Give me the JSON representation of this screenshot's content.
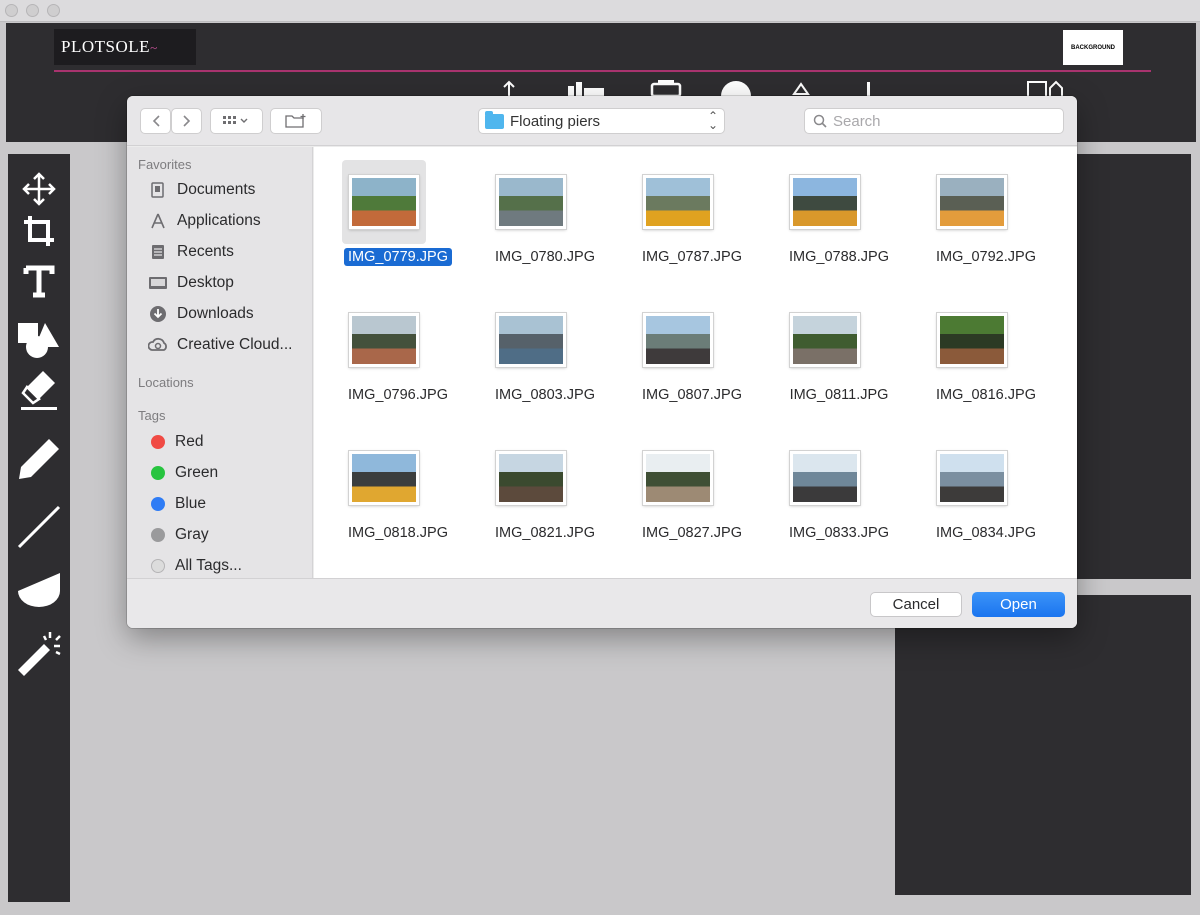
{
  "app": {
    "logo_text": "PLOTSOLE",
    "logo_swash": "~",
    "background_button": "BACKGROUND"
  },
  "dialog": {
    "path": "Floating piers",
    "search_placeholder": "Search",
    "sidebar": {
      "favorites_header": "Favorites",
      "favorites": [
        {
          "label": "Documents",
          "icon": "documents-icon"
        },
        {
          "label": "Applications",
          "icon": "applications-icon"
        },
        {
          "label": "Recents",
          "icon": "recents-icon"
        },
        {
          "label": "Desktop",
          "icon": "desktop-icon"
        },
        {
          "label": "Downloads",
          "icon": "downloads-icon"
        },
        {
          "label": "Creative Cloud...",
          "icon": "creative-cloud-icon"
        }
      ],
      "locations_header": "Locations",
      "tags_header": "Tags",
      "tags": [
        {
          "label": "Red",
          "color": "#f04a44"
        },
        {
          "label": "Green",
          "color": "#27c43f"
        },
        {
          "label": "Blue",
          "color": "#2f7cf5"
        },
        {
          "label": "Gray",
          "color": "#9a9a9c"
        },
        {
          "label": "All Tags...",
          "color": "#dcdcdc"
        }
      ]
    },
    "files": [
      {
        "name": "IMG_0779.JPG",
        "selected": true,
        "colors": [
          "#8db3c9",
          "#4f7a3a",
          "#c26a3a"
        ]
      },
      {
        "name": "IMG_0780.JPG",
        "selected": false,
        "colors": [
          "#9ab8cc",
          "#55704a",
          "#6f7a7f"
        ]
      },
      {
        "name": "IMG_0787.JPG",
        "selected": false,
        "colors": [
          "#9fc0d8",
          "#6b7a5f",
          "#e0a220"
        ]
      },
      {
        "name": "IMG_0788.JPG",
        "selected": false,
        "colors": [
          "#8cb6df",
          "#3e4a40",
          "#d9982b"
        ]
      },
      {
        "name": "IMG_0792.JPG",
        "selected": false,
        "colors": [
          "#9ab0bf",
          "#5a5f54",
          "#e39c3c"
        ]
      },
      {
        "name": "IMG_0796.JPG",
        "selected": false,
        "colors": [
          "#b9c7d0",
          "#44513c",
          "#a9674a"
        ]
      },
      {
        "name": "IMG_0803.JPG",
        "selected": false,
        "colors": [
          "#a9c2d3",
          "#56616a",
          "#4f6d86"
        ]
      },
      {
        "name": "IMG_0807.JPG",
        "selected": false,
        "colors": [
          "#a7c6e0",
          "#6b7d78",
          "#3e3a3b"
        ]
      },
      {
        "name": "IMG_0811.JPG",
        "selected": false,
        "colors": [
          "#c5d3dc",
          "#3f5c30",
          "#7a7067"
        ]
      },
      {
        "name": "IMG_0816.JPG",
        "selected": false,
        "colors": [
          "#4c7a33",
          "#2c3a24",
          "#8b5a3a"
        ]
      },
      {
        "name": "IMG_0818.JPG",
        "selected": false,
        "colors": [
          "#8fb8db",
          "#3b3e3e",
          "#e0a730"
        ]
      },
      {
        "name": "IMG_0821.JPG",
        "selected": false,
        "colors": [
          "#c6d6e2",
          "#3b4a2f",
          "#5c4a3c"
        ]
      },
      {
        "name": "IMG_0827.JPG",
        "selected": false,
        "colors": [
          "#e9eef1",
          "#3f4f35",
          "#9d8a74"
        ]
      },
      {
        "name": "IMG_0833.JPG",
        "selected": false,
        "colors": [
          "#dbe6ee",
          "#6f8799",
          "#3b3a3b"
        ]
      },
      {
        "name": "IMG_0834.JPG",
        "selected": false,
        "colors": [
          "#cfe0ee",
          "#7b8fa0",
          "#3d3b3a"
        ]
      }
    ],
    "cancel_label": "Cancel",
    "open_label": "Open"
  }
}
